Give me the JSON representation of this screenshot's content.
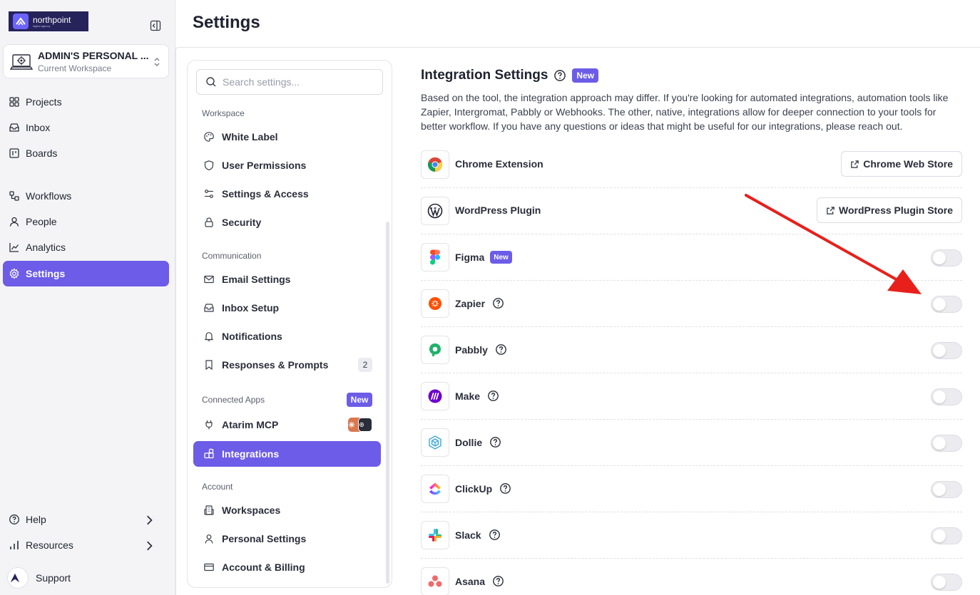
{
  "sidebar": {
    "logo_text": "northpoint",
    "logo_sub": "digital agency",
    "workspace": {
      "name": "ADMIN'S PERSONAL ...",
      "subtitle": "Current Workspace"
    },
    "nav": [
      {
        "label": "Projects",
        "icon": "grid-icon"
      },
      {
        "label": "Inbox",
        "icon": "inbox-icon"
      },
      {
        "label": "Boards",
        "icon": "board-icon"
      },
      {
        "label": "Workflows",
        "icon": "workflow-icon"
      },
      {
        "label": "People",
        "icon": "person-icon"
      },
      {
        "label": "Analytics",
        "icon": "chart-icon"
      },
      {
        "label": "Settings",
        "icon": "gear-icon",
        "active": true
      }
    ],
    "footer": [
      {
        "label": "Help",
        "icon": "help-icon"
      },
      {
        "label": "Resources",
        "icon": "bar-icon"
      },
      {
        "label": "Support",
        "icon": "support-avatar"
      }
    ]
  },
  "page": {
    "title": "Settings"
  },
  "settings_menu": {
    "search_placeholder": "Search settings...",
    "sections": [
      {
        "heading": "Workspace",
        "items": [
          "White Label",
          "User Permissions",
          "Settings & Access",
          "Security"
        ]
      },
      {
        "heading": "Communication",
        "items": [
          "Email Settings",
          "Inbox Setup",
          "Notifications",
          "Responses & Prompts"
        ],
        "responses_count": "2"
      },
      {
        "heading": "Connected Apps",
        "badge": "New",
        "items": [
          "Atarim MCP",
          "Integrations"
        ]
      },
      {
        "heading": "Account",
        "items": [
          "Workspaces",
          "Personal Settings",
          "Account & Billing"
        ]
      }
    ]
  },
  "integrations": {
    "title": "Integration Settings",
    "title_badge": "New",
    "description": "Based on the tool, the integration approach may differ. If you're looking for automated integrations, automation tools like Zapier, Intergromat, Pabbly or Webhooks. The other, native, integrations allow for deeper connection to your tools for better workflow. If you have any questions or ideas that might be useful for our integrations, please reach out.",
    "rows": [
      {
        "name": "Chrome Extension",
        "action": "Chrome Web Store"
      },
      {
        "name": "WordPress Plugin",
        "action": "WordPress Plugin Store"
      },
      {
        "name": "Figma",
        "badge": "New",
        "enabled": false
      },
      {
        "name": "Zapier",
        "enabled": false
      },
      {
        "name": "Pabbly",
        "enabled": false
      },
      {
        "name": "Make",
        "enabled": false
      },
      {
        "name": "Dollie",
        "enabled": false
      },
      {
        "name": "ClickUp",
        "enabled": false
      },
      {
        "name": "Slack",
        "enabled": false
      },
      {
        "name": "Asana",
        "enabled": false
      }
    ]
  },
  "colors": {
    "accent": "#6c5ce7",
    "arrow": "#e8201c"
  }
}
